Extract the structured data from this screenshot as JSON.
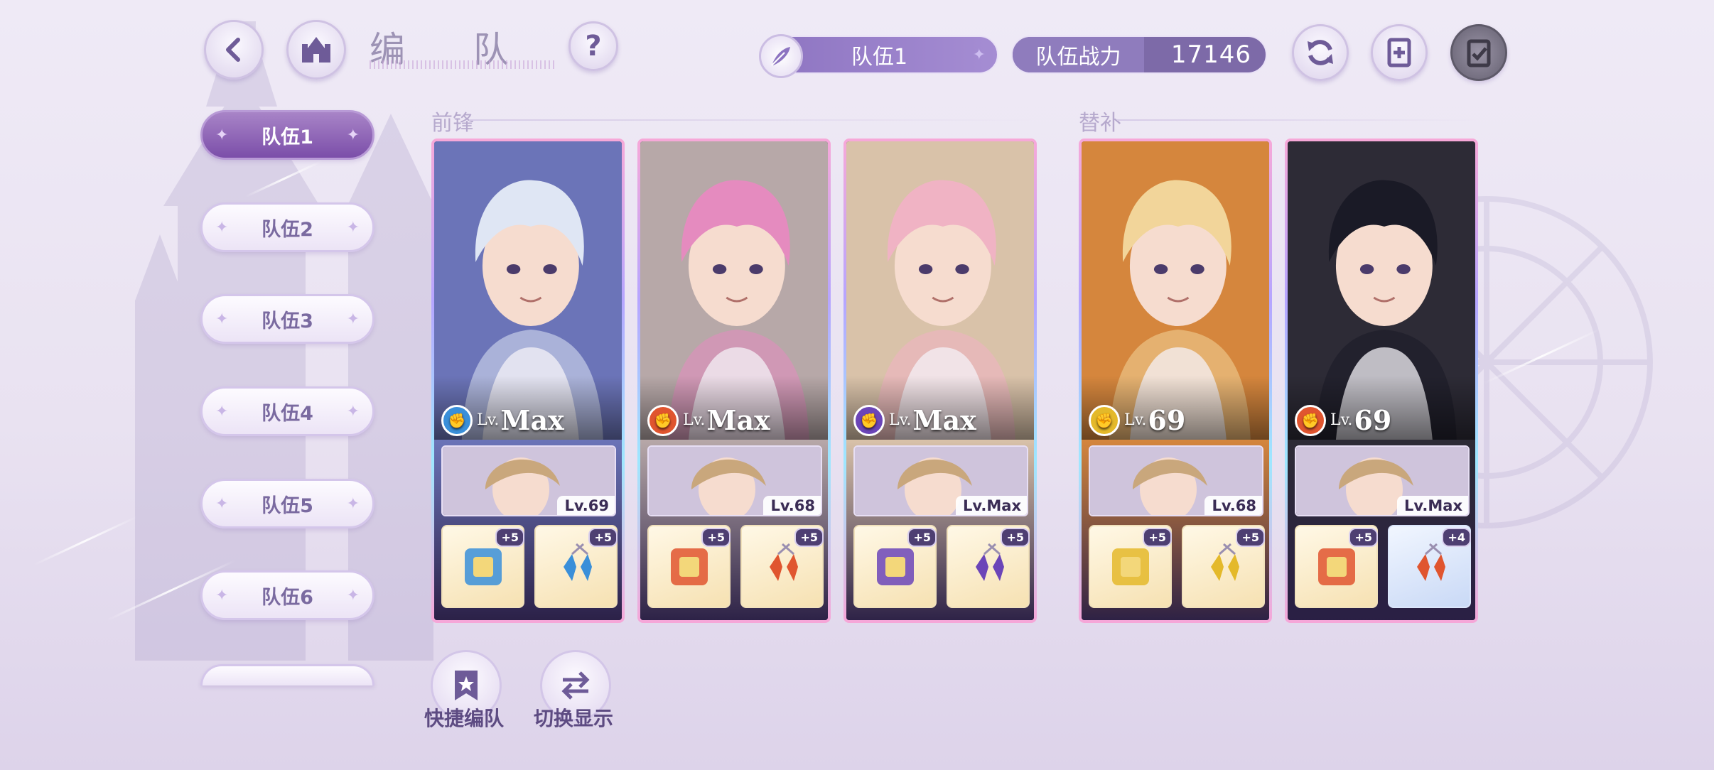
{
  "header": {
    "title": "编 队",
    "team_selector": "队伍1",
    "power_label": "队伍战力",
    "power_value": "17146"
  },
  "sidebar": {
    "teams": [
      "队伍1",
      "队伍2",
      "队伍3",
      "队伍4",
      "队伍5",
      "队伍6"
    ],
    "active_index": 0
  },
  "sections": {
    "front": "前锋",
    "sub": "替补"
  },
  "cards": [
    {
      "lv_prefix": "Lv.",
      "level": "Max",
      "element": "blue",
      "element_color": "#3a8fd9",
      "partner_level": "Lv.69",
      "equip": [
        {
          "plus": "+5",
          "bg": "gold"
        },
        {
          "plus": "+5",
          "bg": "gold"
        }
      ],
      "hair": "#dfe6f4",
      "bgc": "#6b74b8"
    },
    {
      "lv_prefix": "Lv.",
      "level": "Max",
      "element": "red",
      "element_color": "#e0552f",
      "partner_level": "Lv.68",
      "equip": [
        {
          "plus": "+5",
          "bg": "gold"
        },
        {
          "plus": "+5",
          "bg": "gold"
        }
      ],
      "hair": "#e58bbf",
      "bgc": "#b7a8a8"
    },
    {
      "lv_prefix": "Lv.",
      "level": "Max",
      "element": "purple",
      "element_color": "#6b45b8",
      "partner_level": "Lv.Max",
      "equip": [
        {
          "plus": "+5",
          "bg": "gold"
        },
        {
          "plus": "+5",
          "bg": "gold"
        }
      ],
      "hair": "#f0b3c4",
      "bgc": "#d9c2a9"
    },
    {
      "lv_prefix": "Lv.",
      "level": "69",
      "element": "yellow",
      "element_color": "#e4b92a",
      "partner_level": "Lv.68",
      "equip": [
        {
          "plus": "+5",
          "bg": "gold"
        },
        {
          "plus": "+5",
          "bg": "gold"
        }
      ],
      "hair": "#f2d59a",
      "bgc": "#d5863d"
    },
    {
      "lv_prefix": "Lv.",
      "level": "69",
      "element": "red",
      "element_color": "#e0552f",
      "partner_level": "Lv.Max",
      "equip": [
        {
          "plus": "+5",
          "bg": "gold"
        },
        {
          "plus": "+4",
          "bg": "blue"
        }
      ],
      "hair": "#1a1a26",
      "bgc": "#2d2b36"
    }
  ],
  "actions": {
    "quick_team": "快捷编队",
    "switch_display": "切换显示"
  },
  "colors": {
    "accent": "#7b4ea9",
    "power_bg": "#7d6aa8"
  }
}
